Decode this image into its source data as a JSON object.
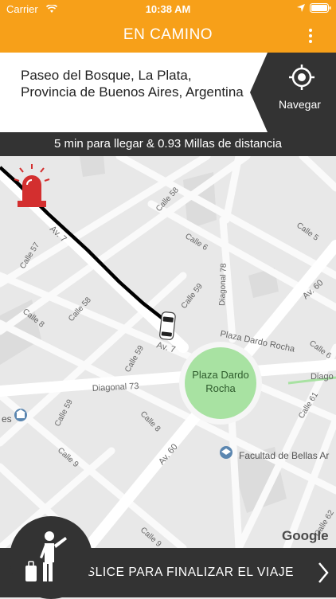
{
  "status_bar": {
    "carrier": "Carrier",
    "time": "10:38 AM"
  },
  "header": {
    "title": "EN CAMINO"
  },
  "destination": {
    "address": "Paseo del Bosque, La Plata, Provincia de Buenos Aires, Argentina"
  },
  "navigate": {
    "label": "Navegar"
  },
  "eta": {
    "text": "5 min para llegar  & 0.93 Millas de distancia"
  },
  "map": {
    "labels": {
      "plaza": [
        "Plaza Dardo",
        "Rocha"
      ],
      "plaza_dardo_rocha_street": "Plaza Dardo Rocha",
      "diagonal_73": "Diagonal 73",
      "diagonal_78": "Diagonal 78",
      "diagonal_right": "Diago",
      "av_60": "Av. 60",
      "av_60_b": "Av. 60",
      "av_7": "Av. 7",
      "av_7_b": "Av. 7",
      "calle_5": "Calle 5",
      "calle_6": "Calle 6",
      "calle_6_b": "Calle 6",
      "calle_57": "Calle 57",
      "calle_58": "Calle 58",
      "calle_58_b": "Calle 58",
      "calle_59": "Calle 59",
      "calle_59_b": "Calle 59",
      "calle_59_c": "Calle 59",
      "calle_8": "Calle 8",
      "calle_8_b": "Calle 8",
      "calle_9": "Calle 9",
      "calle_9_b": "Calle 9",
      "calle_61": "Calle 61",
      "calle_62": "Calle 62",
      "facultad": "Facultad de Bellas Ar",
      "museum_partial": "es",
      "google": "Google"
    }
  },
  "slider": {
    "label": "DESLICE PARA FINALIZAR EL VIAJE"
  },
  "colors": {
    "accent": "#f7a019",
    "dark": "#333333",
    "park": "#a8e2a2",
    "alert": "#d32f2f"
  }
}
